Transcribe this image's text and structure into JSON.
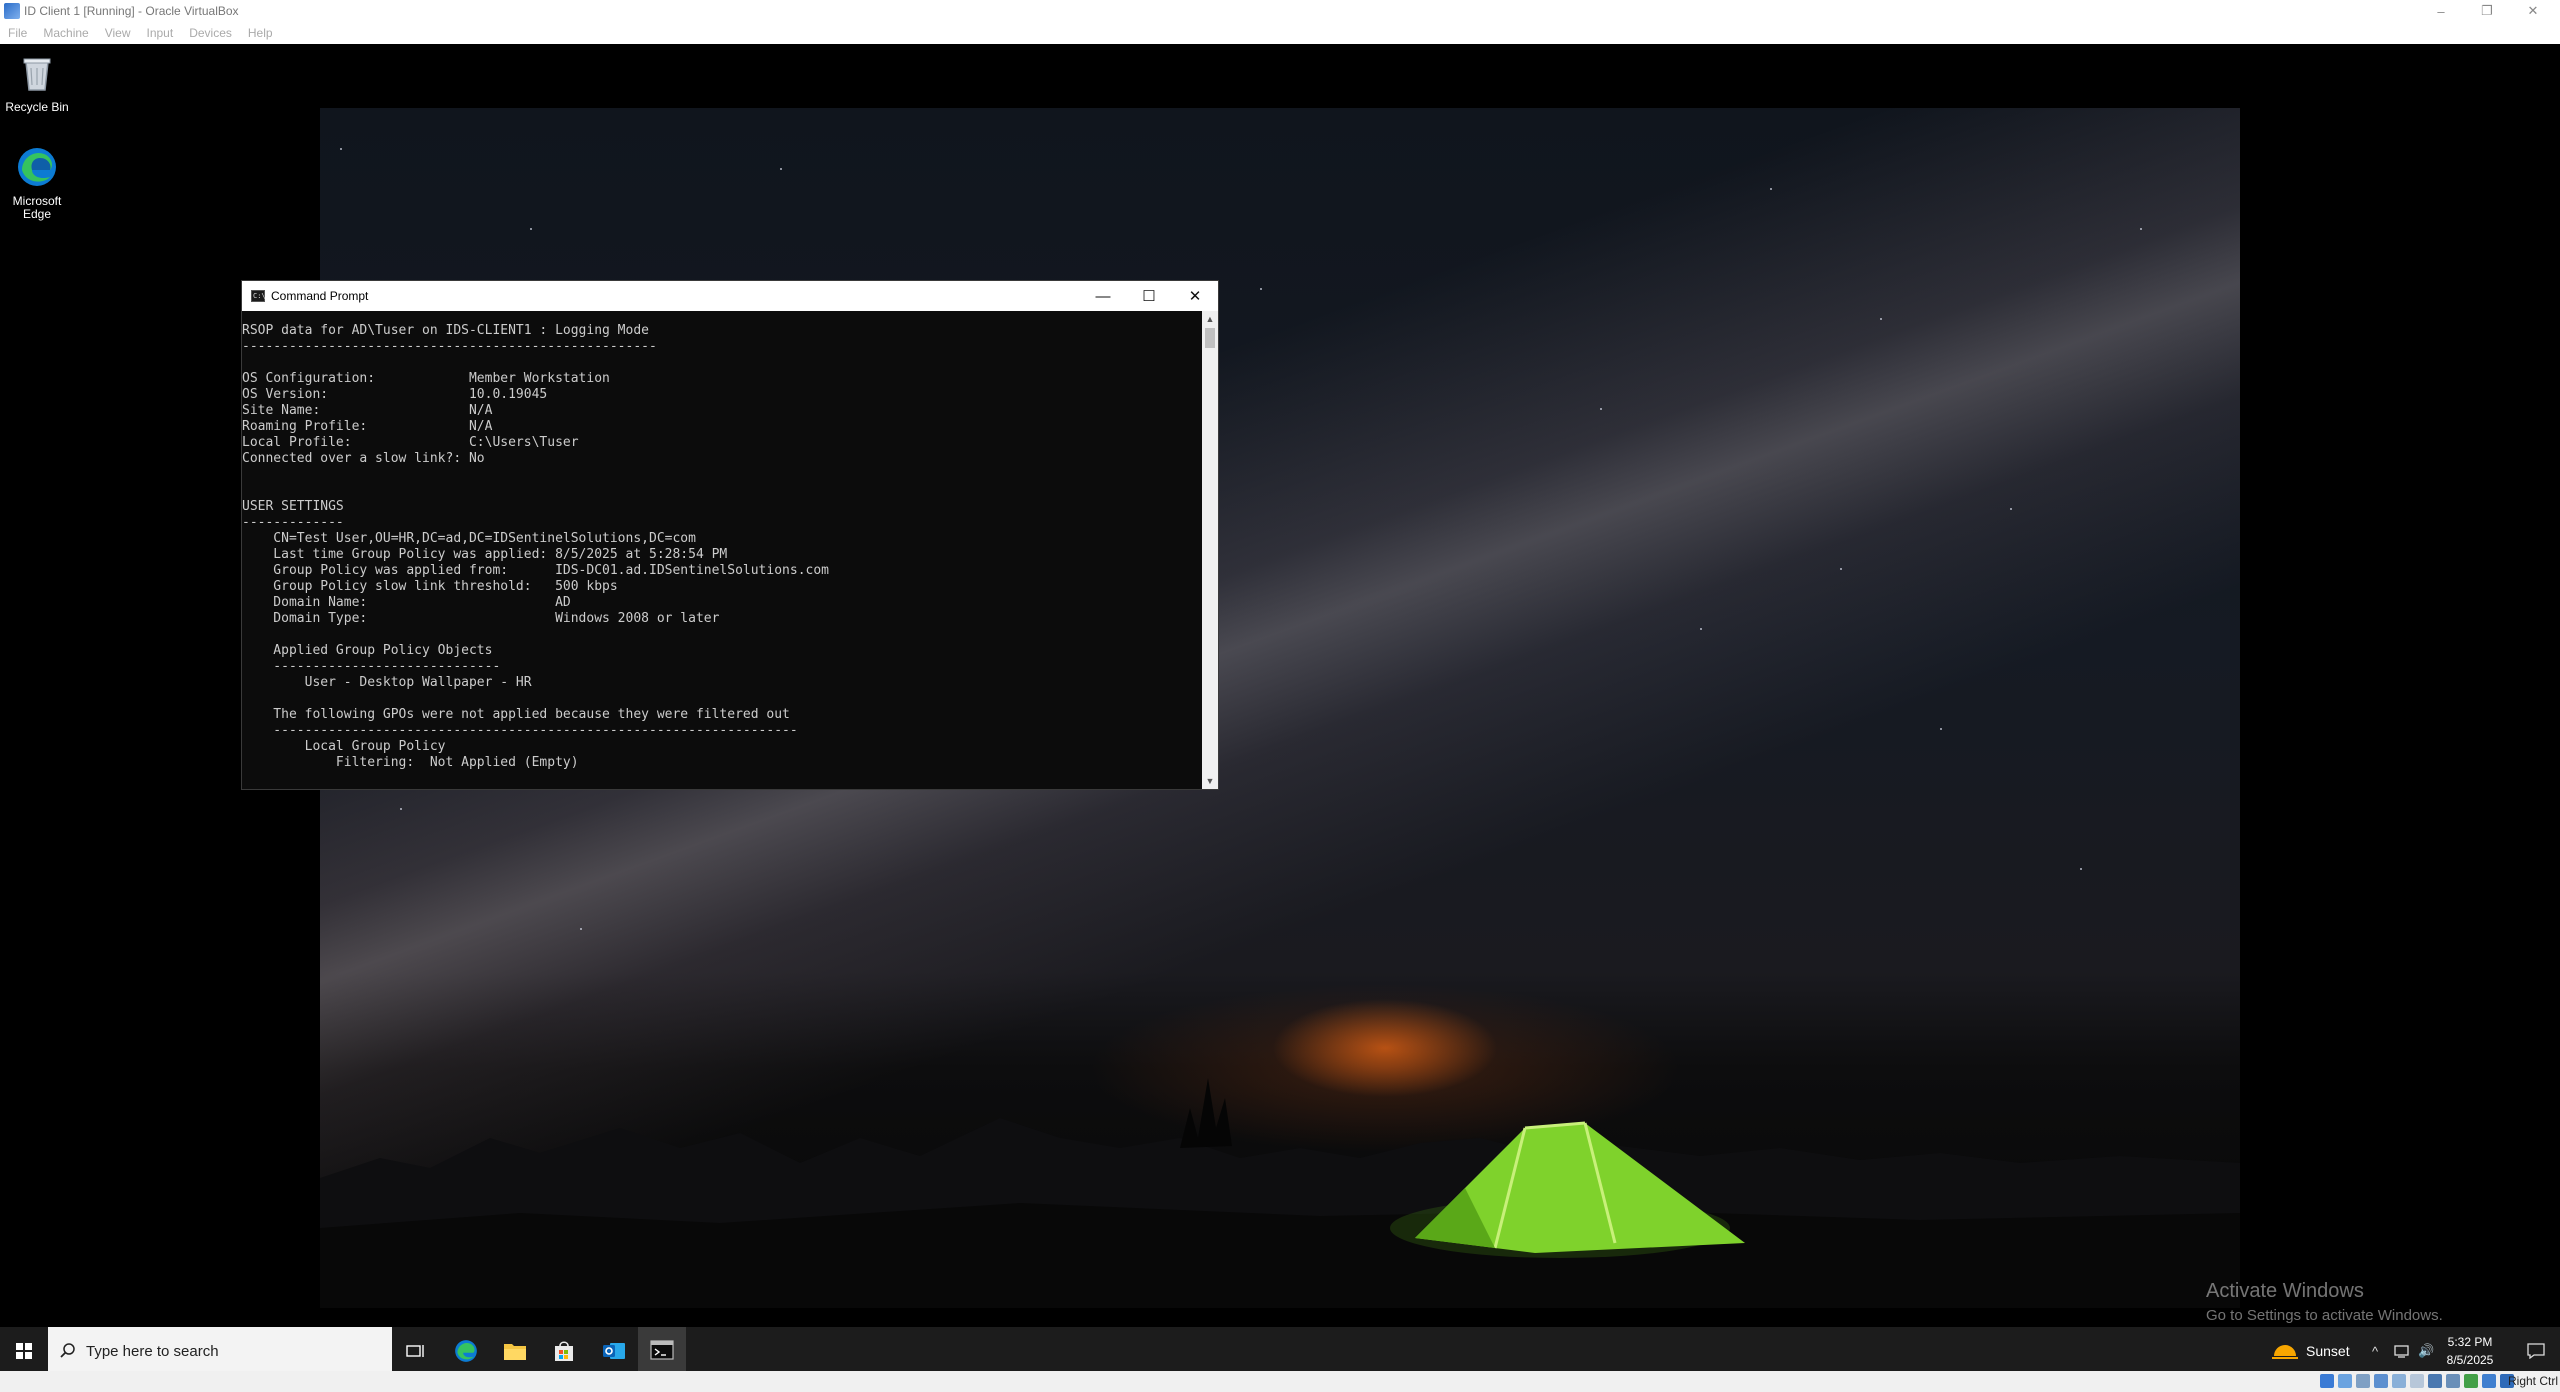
{
  "host_window": {
    "title": "ID Client 1 [Running] - Oracle VirtualBox",
    "menu": [
      "File",
      "Machine",
      "View",
      "Input",
      "Devices",
      "Help"
    ],
    "controls": {
      "minimize": "–",
      "restore": "❐",
      "close": "✕"
    }
  },
  "desktop": {
    "icons": [
      {
        "label": "Recycle Bin",
        "icon": "recycle-bin-icon"
      },
      {
        "label": "Microsoft Edge",
        "icon": "edge-icon"
      }
    ]
  },
  "cmd_window": {
    "title": "Command Prompt",
    "icon_glyph": "C:\\",
    "controls": {
      "minimize": "—",
      "maximize": "☐",
      "close": "✕"
    },
    "lines": [
      "RSOP data for AD\\Tuser on IDS-CLIENT1 : Logging Mode",
      "-----------------------------------------------------",
      "",
      "OS Configuration:            Member Workstation",
      "OS Version:                  10.0.19045",
      "Site Name:                   N/A",
      "Roaming Profile:             N/A",
      "Local Profile:               C:\\Users\\Tuser",
      "Connected over a slow link?: No",
      "",
      "",
      "USER SETTINGS",
      "-------------",
      "    CN=Test User,OU=HR,DC=ad,DC=IDSentinelSolutions,DC=com",
      "    Last time Group Policy was applied: 8/5/2025 at 5:28:54 PM",
      "    Group Policy was applied from:      IDS-DC01.ad.IDSentinelSolutions.com",
      "    Group Policy slow link threshold:   500 kbps",
      "    Domain Name:                        AD",
      "    Domain Type:                        Windows 2008 or later",
      "",
      "    Applied Group Policy Objects",
      "    -----------------------------",
      "        User - Desktop Wallpaper - HR",
      "",
      "    The following GPOs were not applied because they were filtered out",
      "    -------------------------------------------------------------------",
      "        Local Group Policy",
      "            Filtering:  Not Applied (Empty)"
    ],
    "scroll_arrows": {
      "up": "▲",
      "down": "▼"
    }
  },
  "watermark": {
    "title": "Activate Windows",
    "subtitle": "Go to Settings to activate Windows."
  },
  "taskbar": {
    "search_placeholder": "Type here to search",
    "apps": [
      "task-view-icon",
      "edge-icon",
      "file-explorer-icon",
      "store-icon",
      "outlook-icon",
      "command-prompt-icon"
    ],
    "active_app": "command-prompt-icon",
    "weather": "Sunset",
    "tray_glyphs": {
      "chevron": "^",
      "volume": "🔊"
    },
    "clock_time": "5:32 PM",
    "clock_date": "8/5/2025"
  },
  "vbox_status": {
    "host_key": "Right Ctrl"
  },
  "colors": {
    "console_bg": "#0c0c0c",
    "console_text": "#cccccc",
    "taskbar_bg": "#1c1c1c",
    "tent_green": "#7fd22c",
    "horizon_orange": "#ff6e14"
  }
}
